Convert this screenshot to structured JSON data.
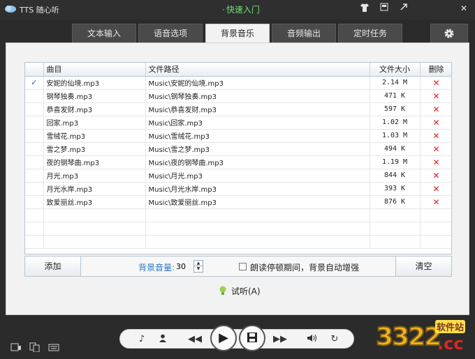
{
  "titlebar": {
    "title": "TTS 随心听",
    "quick_link": "快速入门",
    "buttons": [
      "shirt-icon",
      "minimize-box-icon",
      "restore-icon",
      "close-icon"
    ]
  },
  "tabs": [
    {
      "label": "文本输入",
      "active": false
    },
    {
      "label": "语音选项",
      "active": false
    },
    {
      "label": "背景音乐",
      "active": true
    },
    {
      "label": "音频输出",
      "active": false
    },
    {
      "label": "定时任务",
      "active": false
    }
  ],
  "table": {
    "headers": {
      "title": "曲目",
      "path": "文件路径",
      "size": "文件大小",
      "delete": "删除"
    },
    "rows": [
      {
        "mark": "✓",
        "title": "安妮的仙境.mp3",
        "path": "Music\\安妮的仙境.mp3",
        "size": "2.14 M"
      },
      {
        "mark": "",
        "title": "钢琴独奏.mp3",
        "path": "Music\\钢琴独奏.mp3",
        "size": "471 K"
      },
      {
        "mark": "",
        "title": "恭喜发财.mp3",
        "path": "Music\\恭喜发财.mp3",
        "size": "597 K"
      },
      {
        "mark": "",
        "title": "回家.mp3",
        "path": "Music\\回家.mp3",
        "size": "1.02 M"
      },
      {
        "mark": "",
        "title": "雪绒花.mp3",
        "path": "Music\\雪绒花.mp3",
        "size": "1.03 M"
      },
      {
        "mark": "",
        "title": "雪之梦.mp3",
        "path": "Music\\雪之梦.mp3",
        "size": "494 K"
      },
      {
        "mark": "",
        "title": "夜的钢琴曲.mp3",
        "path": "Music\\夜的钢琴曲.mp3",
        "size": "1.19 M"
      },
      {
        "mark": "",
        "title": "月光.mp3",
        "path": "Music\\月光.mp3",
        "size": "844 K"
      },
      {
        "mark": "",
        "title": "月光水岸.mp3",
        "path": "Music\\月光水岸.mp3",
        "size": "393 K"
      },
      {
        "mark": "",
        "title": "致爱丽丝.mp3",
        "path": "Music\\致爱丽丝.mp3",
        "size": "876 K"
      }
    ],
    "delete_symbol": "✕"
  },
  "controls": {
    "add_label": "添加",
    "clear_label": "清空",
    "volume_label": "背景音量:",
    "volume_value": "30",
    "auto_boost_label": "朗读停顿期间，背景自动增强",
    "auto_boost_checked": false,
    "listen_label": "试听(A)"
  },
  "player": {
    "buttons": [
      "music-voice-icon",
      "speaker-person-icon",
      "rewind-icon",
      "play-icon",
      "save-icon",
      "fast-forward-icon",
      "volume-icon",
      "repeat-icon"
    ]
  },
  "watermark": {
    "number": "3322",
    "site": "软件站",
    "domain": ".cc"
  }
}
